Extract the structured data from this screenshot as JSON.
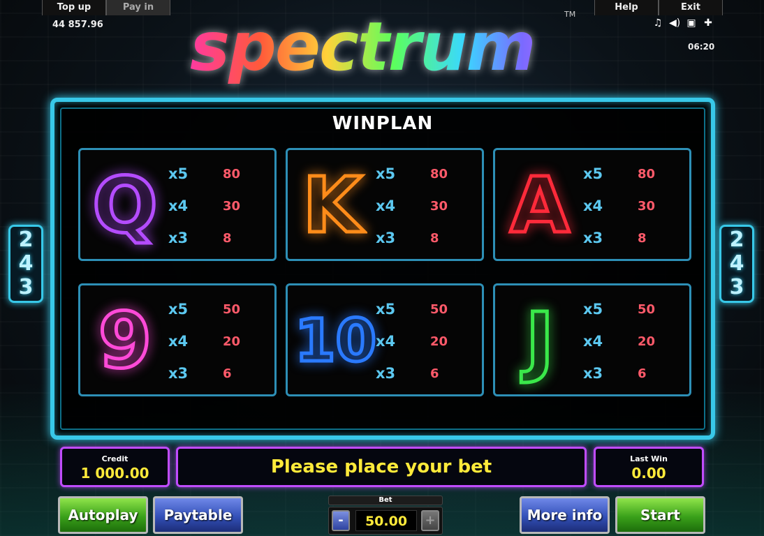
{
  "header": {
    "top_up_label": "Top up",
    "pay_in_label": "Pay in",
    "help_label": "Help",
    "exit_label": "Exit",
    "balance": "44 857.96",
    "time": "06:20",
    "icons": [
      "music-note-icon",
      "speaker-icon",
      "screen-icon",
      "settings-icon"
    ]
  },
  "logo": {
    "text": "spectrum",
    "trademark": "TM"
  },
  "side_badge": [
    "2",
    "4",
    "3"
  ],
  "winplan": {
    "title": "WINPLAN",
    "symbols": [
      {
        "symbol": "Q",
        "color": "#b44cff",
        "payouts": [
          {
            "mult": "x5",
            "pay": "80"
          },
          {
            "mult": "x4",
            "pay": "30"
          },
          {
            "mult": "x3",
            "pay": "8"
          }
        ]
      },
      {
        "symbol": "K",
        "color": "#ff8c1a",
        "payouts": [
          {
            "mult": "x5",
            "pay": "80"
          },
          {
            "mult": "x4",
            "pay": "30"
          },
          {
            "mult": "x3",
            "pay": "8"
          }
        ]
      },
      {
        "symbol": "A",
        "color": "#ff2a3a",
        "payouts": [
          {
            "mult": "x5",
            "pay": "80"
          },
          {
            "mult": "x4",
            "pay": "30"
          },
          {
            "mult": "x3",
            "pay": "8"
          }
        ]
      },
      {
        "symbol": "9",
        "color": "#ff4ad8",
        "payouts": [
          {
            "mult": "x5",
            "pay": "50"
          },
          {
            "mult": "x4",
            "pay": "20"
          },
          {
            "mult": "x3",
            "pay": "6"
          }
        ]
      },
      {
        "symbol": "10",
        "color": "#2a7aff",
        "payouts": [
          {
            "mult": "x5",
            "pay": "50"
          },
          {
            "mult": "x4",
            "pay": "20"
          },
          {
            "mult": "x3",
            "pay": "6"
          }
        ]
      },
      {
        "symbol": "J",
        "color": "#3ae84a",
        "payouts": [
          {
            "mult": "x5",
            "pay": "50"
          },
          {
            "mult": "x4",
            "pay": "20"
          },
          {
            "mult": "x3",
            "pay": "6"
          }
        ]
      }
    ]
  },
  "status": {
    "credit_label": "Credit",
    "credit_value": "1 000.00",
    "message": "Please place your bet",
    "last_win_label": "Last Win",
    "last_win_value": "0.00"
  },
  "controls": {
    "autoplay_label": "Autoplay",
    "paytable_label": "Paytable",
    "bet_label": "Bet",
    "bet_minus": "-",
    "bet_value": "50.00",
    "bet_plus": "+",
    "more_info_label": "More info",
    "start_label": "Start"
  },
  "colors": {
    "panel_border": "#38c8e8",
    "info_border": "#c04cff",
    "accent_text": "#ffea3a",
    "multiplier": "#5cc8f0",
    "payout": "#ff5a6a"
  }
}
